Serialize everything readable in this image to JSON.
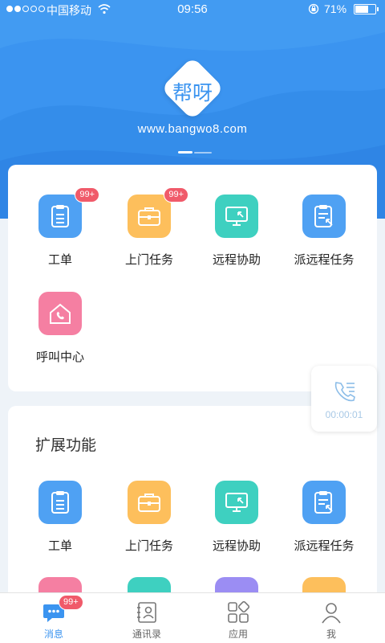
{
  "status_bar": {
    "carrier": "中国移动",
    "time": "09:56",
    "battery_percent": "71%",
    "battery_level": 0.71
  },
  "banner": {
    "logo_text": "帮呀",
    "url": "www.bangwo8.com"
  },
  "main_section": {
    "items": [
      {
        "label": "工单",
        "icon": "clipboard-icon",
        "badge": "99+",
        "color": "#4fa1f3"
      },
      {
        "label": "上门任务",
        "icon": "briefcase-icon",
        "badge": "99+",
        "color": "#fdbf5c"
      },
      {
        "label": "远程协助",
        "icon": "monitor-icon",
        "badge": "",
        "color": "#3ed0c0"
      },
      {
        "label": "派远程任务",
        "icon": "task-clipboard-icon",
        "badge": "",
        "color": "#4fa1f3"
      },
      {
        "label": "呼叫中心",
        "icon": "phone-house-icon",
        "badge": "",
        "color": "#f57fa2"
      }
    ]
  },
  "ext_section": {
    "title": "扩展功能",
    "items": [
      {
        "label": "工单",
        "icon": "clipboard-icon"
      },
      {
        "label": "上门任务",
        "icon": "briefcase-icon"
      },
      {
        "label": "远程协助",
        "icon": "monitor-icon"
      },
      {
        "label": "派远程任务",
        "icon": "task-clipboard-icon"
      }
    ],
    "partial_row_colors": [
      "#f57fa2",
      "#3ed0c0",
      "#9b8df3",
      "#fdbf5c"
    ]
  },
  "call_widget": {
    "timer": "00:00:01",
    "icon": "phone-list-icon"
  },
  "tabbar": {
    "tabs": [
      {
        "label": "消息",
        "icon": "chat-bubble-icon",
        "badge": "99+",
        "active": true
      },
      {
        "label": "通讯录",
        "icon": "contacts-icon",
        "badge": "",
        "active": false
      },
      {
        "label": "应用",
        "icon": "apps-grid-icon",
        "badge": "",
        "active": false
      },
      {
        "label": "我",
        "icon": "user-icon",
        "badge": "",
        "active": false
      }
    ]
  }
}
